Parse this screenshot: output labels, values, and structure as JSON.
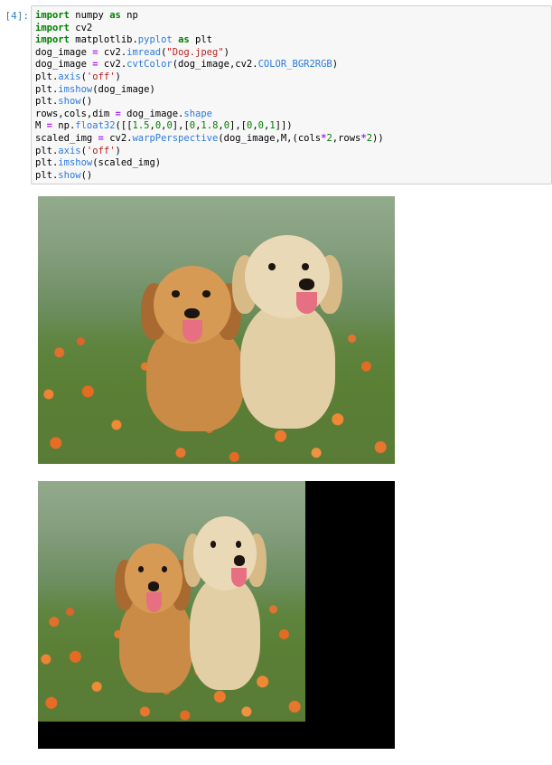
{
  "cell": {
    "prompt": "[4]:",
    "code_lines": [
      "import numpy as np",
      "import cv2",
      "import matplotlib.pyplot as plt",
      "dog_image = cv2.imread(\"Dog.jpeg\")",
      "dog_image = cv2.cvtColor(dog_image,cv2.COLOR_BGR2RGB)",
      "plt.axis('off')",
      "plt.imshow(dog_image)",
      "plt.show()",
      "rows,cols,dim = dog_image.shape",
      "M = np.float32([[1.5,0,0],[0,1.8,0],[0,0,1]])",
      "scaled_img = cv2.warpPerspective(dog_image,M,(cols*2,rows*2))",
      "plt.axis('off')",
      "plt.imshow(scaled_img)",
      "plt.show()"
    ]
  },
  "outputs": [
    {
      "kind": "image",
      "description_icon": "dog-photo"
    },
    {
      "kind": "image",
      "description_icon": "scaled-dog-photo"
    }
  ],
  "colors": {
    "prompt": "#307fc1",
    "cell_bg": "#f7f7f7",
    "cell_border": "#cfcfcf",
    "keyword": "#008000",
    "function": "#2a7bde",
    "operator": "#aa22ff",
    "string": "#ba2121",
    "dog_left": "#c98b45",
    "dog_right": "#e3cfa6"
  }
}
